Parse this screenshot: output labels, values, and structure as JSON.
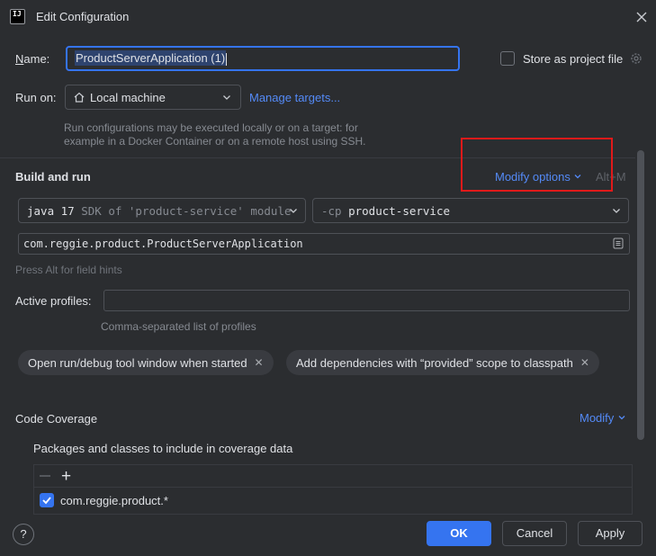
{
  "window": {
    "title": "Edit Configuration",
    "icon_glyph": "IJ"
  },
  "name_row": {
    "label_underlined": "N",
    "label_rest": "ame:",
    "value": "ProductServerApplication (1)",
    "store_label": "Store as project file",
    "store_checked": false
  },
  "run_on": {
    "label": "Run on:",
    "value": "Local machine",
    "manage_link": "Manage targets...",
    "hint": "Run configurations may be executed locally or on a target: for example in a Docker Container or on a remote host using SSH."
  },
  "build_and_run": {
    "title": "Build and run",
    "modify_options": "Modify options",
    "shortcut": "Alt+M",
    "sdk_strong": "java 17",
    "sdk_muted": "SDK of 'product-service' module",
    "cp_flag": "-cp",
    "cp_value": "product-service",
    "main_class": "com.reggie.product.ProductServerApplication",
    "field_hint": "Press Alt for field hints"
  },
  "profiles": {
    "label": "Active profiles:",
    "value": "",
    "hint": "Comma-separated list of profiles"
  },
  "chips": [
    {
      "label": "Open run/debug tool window when started"
    },
    {
      "label": "Add dependencies with “provided” scope to classpath"
    }
  ],
  "coverage": {
    "title": "Code Coverage",
    "modify": "Modify",
    "subtitle": "Packages and classes to include in coverage data",
    "items": [
      {
        "label": "com.reggie.product.*",
        "checked": true
      }
    ]
  },
  "footer": {
    "help": "?",
    "ok": "OK",
    "cancel": "Cancel",
    "apply": "Apply"
  },
  "colors": {
    "background": "#2b2d30",
    "accent": "#3574f0",
    "link": "#548af7",
    "highlight_box": "#e01a1a"
  }
}
